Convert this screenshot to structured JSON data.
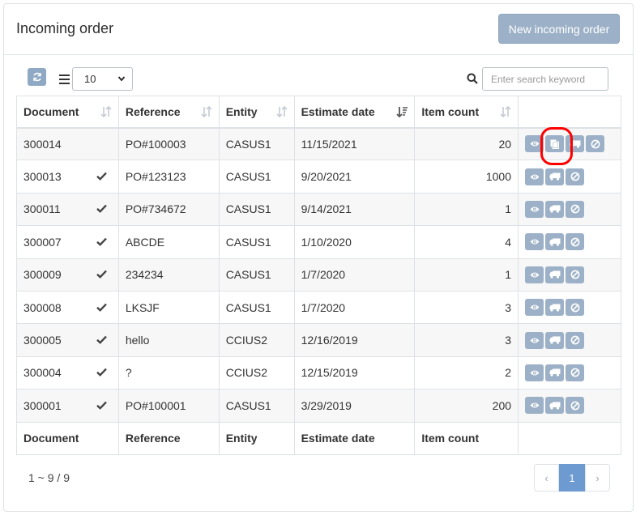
{
  "header": {
    "title": "Incoming order",
    "new_button": "New incoming order"
  },
  "toolbar": {
    "page_size": "10",
    "search_placeholder": "Enter search keyword"
  },
  "columns": [
    "Document",
    "Reference",
    "Entity",
    "Estimate date",
    "Item count"
  ],
  "rows": [
    {
      "document": "300014",
      "checked": false,
      "reference": "PO#100003",
      "entity": "CASUS1",
      "date": "11/15/2021",
      "count": "20"
    },
    {
      "document": "300013",
      "checked": true,
      "reference": "PO#123123",
      "entity": "CASUS1",
      "date": "9/20/2021",
      "count": "1000"
    },
    {
      "document": "300011",
      "checked": true,
      "reference": "PO#734672",
      "entity": "CASUS1",
      "date": "9/14/2021",
      "count": "1"
    },
    {
      "document": "300007",
      "checked": true,
      "reference": "ABCDE",
      "entity": "CASUS1",
      "date": "1/10/2020",
      "count": "4"
    },
    {
      "document": "300009",
      "checked": true,
      "reference": "234234",
      "entity": "CASUS1",
      "date": "1/7/2020",
      "count": "1"
    },
    {
      "document": "300008",
      "checked": true,
      "reference": "LKSJF",
      "entity": "CASUS1",
      "date": "1/7/2020",
      "count": "3"
    },
    {
      "document": "300005",
      "checked": true,
      "reference": "hello",
      "entity": "CCIUS2",
      "date": "12/16/2019",
      "count": "3"
    },
    {
      "document": "300004",
      "checked": true,
      "reference": "?",
      "entity": "CCIUS2",
      "date": "12/15/2019",
      "count": "2"
    },
    {
      "document": "300001",
      "checked": true,
      "reference": "PO#100001",
      "entity": "CASUS1",
      "date": "3/29/2019",
      "count": "200"
    }
  ],
  "footer_columns": [
    "Document",
    "Reference",
    "Entity",
    "Estimate date",
    "Item count"
  ],
  "pagination": {
    "info": "1 ~ 9 / 9",
    "prev": "‹",
    "current": "1",
    "next": "›"
  },
  "colors": {
    "accent": "#9cb1c7",
    "active_page": "#6d9bd1",
    "highlight": "#ff0000"
  },
  "icons": {
    "row_actions_first": [
      "eye-icon",
      "copy-icon",
      "truck-icon",
      "ban-icon"
    ],
    "row_actions": [
      "eye-icon",
      "truck-icon",
      "ban-icon"
    ]
  }
}
